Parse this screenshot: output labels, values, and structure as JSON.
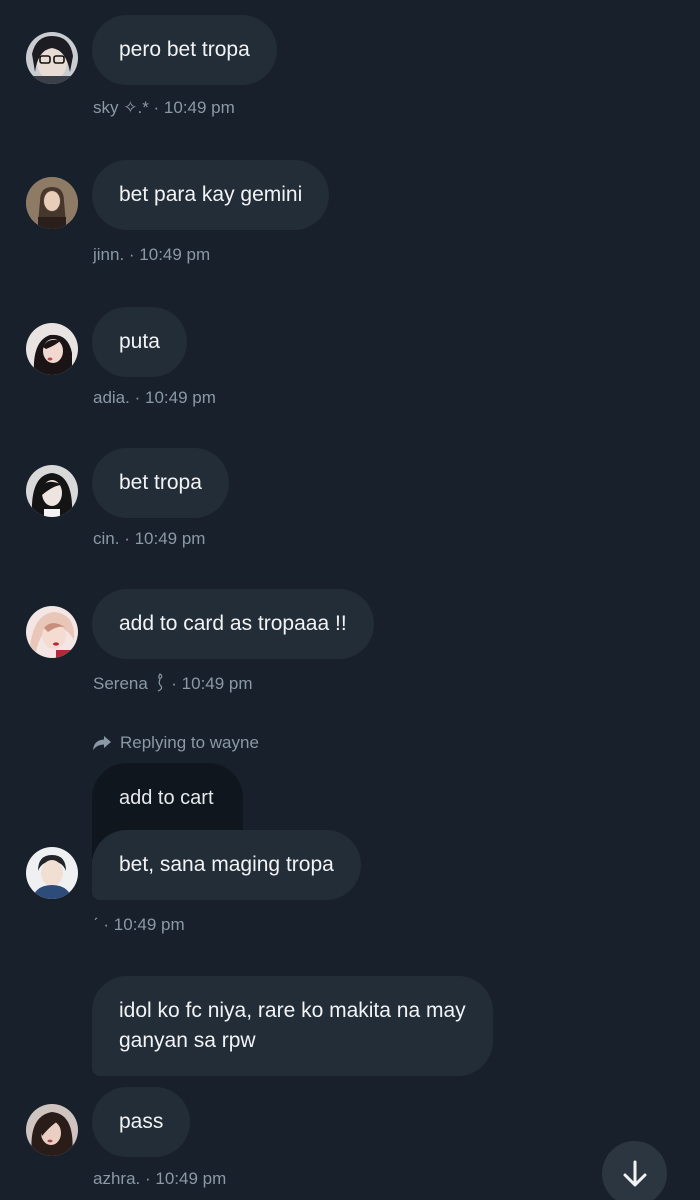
{
  "messages": [
    {
      "id": "m1",
      "text": "pero bet tropa",
      "author": "sky ✧.*",
      "time": "10:49 pm",
      "separator": " · "
    },
    {
      "id": "m2",
      "text": "bet para kay gemini",
      "author": "jinn.",
      "time": "10:49 pm",
      "separator": " · "
    },
    {
      "id": "m3",
      "text": "puta",
      "author": "adia.",
      "time": "10:49 pm",
      "separator": " · "
    },
    {
      "id": "m4",
      "text": "bet tropa",
      "author": "cin.",
      "time": "10:49 pm",
      "separator": " · "
    },
    {
      "id": "m5",
      "text": "add to card as tropaaa !!",
      "author": "Serena",
      "time": "10:49 pm",
      "separator": " · "
    },
    {
      "id": "m6",
      "reply_label": "Replying to wayne",
      "quoted_text": "add to cart",
      "text": "bet, sana maging tropa",
      "author": "ˊ",
      "time": "10:49 pm",
      "separator": " · "
    },
    {
      "id": "m7",
      "text_line1": "idol ko fc niya, rare ko makita na may",
      "text_line2": "ganyan sa rpw"
    },
    {
      "id": "m8",
      "text": "pass",
      "author": "azhra.",
      "time": "10:49 pm",
      "separator": " · "
    }
  ],
  "icons": {
    "reply": "reply-arrow-icon",
    "scroll": "arrow-down-icon"
  },
  "colors": {
    "background": "#17202b",
    "bubble": "#232d38",
    "quoted_bubble": "#0f161e",
    "meta_text": "#8b98a5",
    "message_text": "#f1f3f5"
  }
}
